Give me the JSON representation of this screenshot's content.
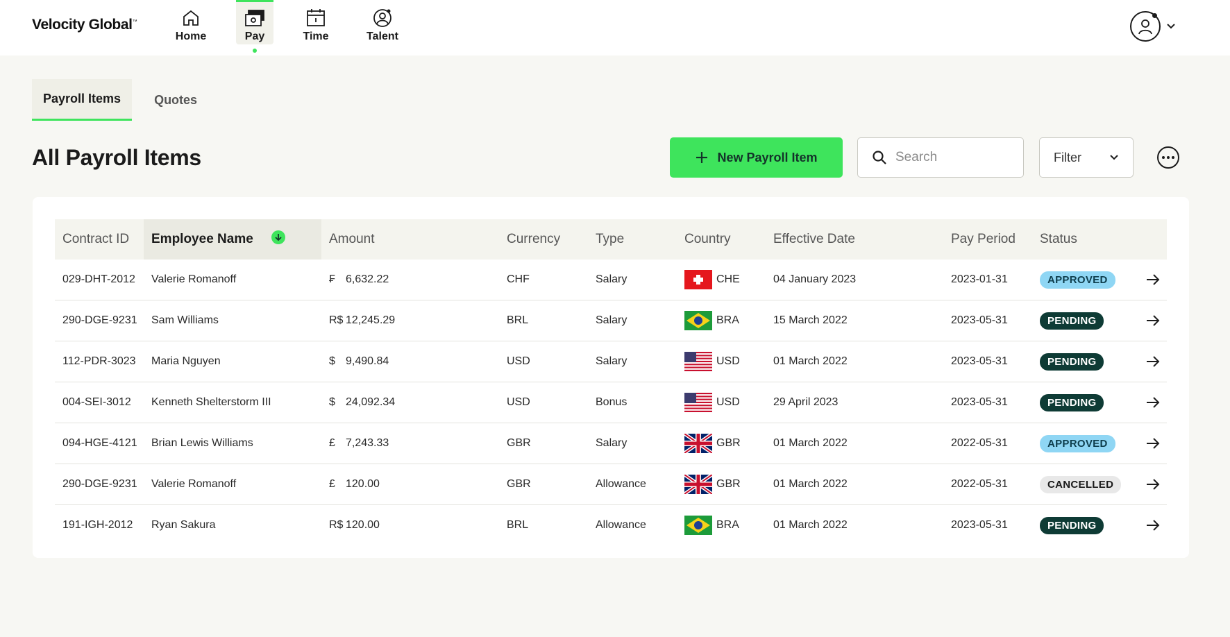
{
  "brand": {
    "name": "Velocity Global",
    "tm": "™",
    "accent": "#3ee45c"
  },
  "nav": {
    "items": [
      {
        "label": "Home",
        "icon": "home-icon"
      },
      {
        "label": "Pay",
        "icon": "pay-icon",
        "active": true
      },
      {
        "label": "Time",
        "icon": "calendar-icon"
      },
      {
        "label": "Talent",
        "icon": "talent-icon"
      }
    ]
  },
  "user": {
    "avatar": "user-avatar-icon",
    "menu_icon": "chevron-down-icon"
  },
  "tabs": [
    {
      "label": "Payroll Items",
      "active": true
    },
    {
      "label": "Quotes",
      "active": false
    }
  ],
  "page": {
    "title": "All Payroll Items",
    "new_button_label": "New Payroll Item",
    "search_placeholder": "Search",
    "filter_label": "Filter"
  },
  "table": {
    "columns": [
      "Contract ID",
      "Employee Name",
      "Amount",
      "Currency",
      "Type",
      "Country",
      "Effective Date",
      "Pay Period",
      "Status"
    ],
    "sorted_column": "Employee Name",
    "sort_direction": "descending",
    "rows": [
      {
        "contract_id": "029-DHT-2012",
        "employee": "Valerie Romanoff",
        "symbol": "₣",
        "amount": "6,632.22",
        "currency": "CHF",
        "type": "Salary",
        "flag": "CHE",
        "country": "CHE",
        "effective_date": "04 January 2023",
        "pay_period": "2023-01-31",
        "status": "APPROVED",
        "status_key": "approved"
      },
      {
        "contract_id": "290-DGE-9231",
        "employee": "Sam Williams",
        "symbol": "R$",
        "amount": "12,245.29",
        "currency": "BRL",
        "type": "Salary",
        "flag": "BRA",
        "country": "BRA",
        "effective_date": "15 March 2022",
        "pay_period": "2023-05-31",
        "status": "PENDING",
        "status_key": "pending"
      },
      {
        "contract_id": "112-PDR-3023",
        "employee": "Maria Nguyen",
        "symbol": "$",
        "amount": "9,490.84",
        "currency": "USD",
        "type": "Salary",
        "flag": "USA",
        "country": "USD",
        "effective_date": "01 March 2022",
        "pay_period": "2023-05-31",
        "status": "PENDING",
        "status_key": "pending"
      },
      {
        "contract_id": "004-SEI-3012",
        "employee": "Kenneth Shelterstorm III",
        "symbol": "$",
        "amount": "24,092.34",
        "currency": "USD",
        "type": "Bonus",
        "flag": "USA",
        "country": "USD",
        "effective_date": "29 April 2023",
        "pay_period": "2023-05-31",
        "status": "PENDING",
        "status_key": "pending"
      },
      {
        "contract_id": "094-HGE-4121",
        "employee": "Brian Lewis Williams",
        "symbol": "£",
        "amount": "7,243.33",
        "currency": "GBR",
        "type": "Salary",
        "flag": "GBR",
        "country": "GBR",
        "effective_date": "01 March 2022",
        "pay_period": "2022-05-31",
        "status": "APPROVED",
        "status_key": "approved"
      },
      {
        "contract_id": "290-DGE-9231",
        "employee": "Valerie Romanoff",
        "symbol": "£",
        "amount": "120.00",
        "currency": "GBR",
        "type": "Allowance",
        "flag": "GBR",
        "country": "GBR",
        "effective_date": "01 March 2022",
        "pay_period": "2022-05-31",
        "status": "CANCELLED",
        "status_key": "cancelled"
      },
      {
        "contract_id": "191-IGH-2012",
        "employee": "Ryan Sakura",
        "symbol": "R$",
        "amount": "120.00",
        "currency": "BRL",
        "type": "Allowance",
        "flag": "BRA",
        "country": "BRA",
        "effective_date": "01 March 2022",
        "pay_period": "2023-05-31",
        "status": "PENDING",
        "status_key": "pending"
      }
    ]
  },
  "status_colors": {
    "approved": "#8fd6f4",
    "pending": "#0e3b35",
    "cancelled": "#e8e8e8"
  }
}
